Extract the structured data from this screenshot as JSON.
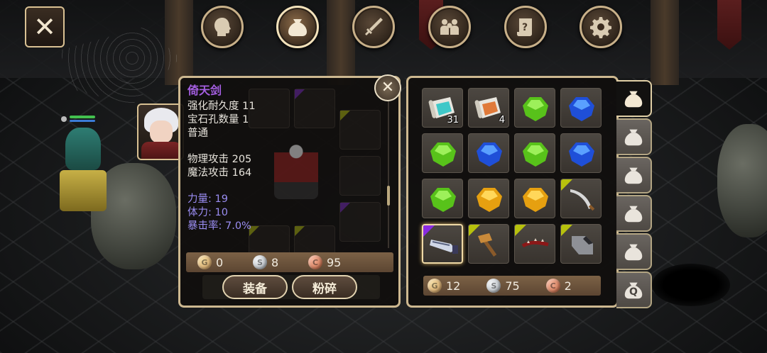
{
  "top_nav": {
    "close_label": "✕",
    "tabs": [
      {
        "icon": "character-head-icon",
        "active": false
      },
      {
        "icon": "bag-icon",
        "active": true
      },
      {
        "icon": "skills-sword-icon",
        "active": false
      },
      {
        "icon": "party-icon",
        "active": false
      },
      {
        "icon": "quest-scroll-icon",
        "active": false
      },
      {
        "icon": "settings-gear-icon",
        "active": false
      }
    ]
  },
  "item_detail": {
    "name": "倚天剑",
    "durability": "强化耐久度 11",
    "gem_slots": "宝石孔数量 1",
    "quality": "普通",
    "physical_attack": "物理攻击 205",
    "magic_attack": "魔法攻击 164",
    "strength": "力量: 19",
    "stamina": "体力: 10",
    "crit_rate": "暴击率: 7.0%",
    "close_label": "✕",
    "scroll_position": 0.65
  },
  "sell_price": {
    "gold": "0",
    "silver": "8",
    "copper": "95"
  },
  "actions": {
    "equip_label": "装备",
    "smash_label": "粉碎"
  },
  "inventory": {
    "items": [
      {
        "icon": "teal-scroll-icon",
        "qty": "31",
        "rarity": ""
      },
      {
        "icon": "orange-scroll-icon",
        "qty": "4",
        "rarity": ""
      },
      {
        "icon": "green-gem-icon",
        "qty": "",
        "rarity": ""
      },
      {
        "icon": "blue-gem-icon",
        "qty": "",
        "rarity": ""
      },
      {
        "icon": "green-gem-icon",
        "qty": "",
        "rarity": ""
      },
      {
        "icon": "blue-gem-icon",
        "qty": "",
        "rarity": ""
      },
      {
        "icon": "green-gem-icon",
        "qty": "",
        "rarity": ""
      },
      {
        "icon": "blue-gem-icon",
        "qty": "",
        "rarity": ""
      },
      {
        "icon": "green-gem-icon",
        "qty": "",
        "rarity": ""
      },
      {
        "icon": "yellow-gem-icon",
        "qty": "",
        "rarity": ""
      },
      {
        "icon": "yellow-gem-icon",
        "qty": "",
        "rarity": ""
      },
      {
        "icon": "curved-sword-icon",
        "qty": "",
        "rarity": "yellow"
      },
      {
        "icon": "broadsword-icon",
        "qty": "",
        "rarity": "purple",
        "selected": true
      },
      {
        "icon": "hammer-icon",
        "qty": "",
        "rarity": "yellow"
      },
      {
        "icon": "spiked-whip-icon",
        "qty": "",
        "rarity": "yellow"
      },
      {
        "icon": "gauntlet-icon",
        "qty": "",
        "rarity": "yellow"
      }
    ],
    "money": {
      "gold": "12",
      "silver": "75",
      "copper": "2"
    }
  },
  "bag_tabs": [
    {
      "icon": "bag-icon",
      "label": "",
      "active": true
    },
    {
      "icon": "bag-icon",
      "label": "",
      "active": false
    },
    {
      "icon": "bag-icon",
      "label": "",
      "active": false
    },
    {
      "icon": "bag-icon",
      "label": "",
      "active": false
    },
    {
      "icon": "bag-icon",
      "label": "",
      "active": false
    },
    {
      "icon": "quest-bag-icon",
      "label": "Q",
      "active": false
    }
  ],
  "colors": {
    "item_name": "#a45ee0",
    "bonus_attr": "#9a8df2",
    "frame_gold": "#cdb890",
    "rarity_purple": "#8a2be2",
    "rarity_yellow": "#b7c10d"
  }
}
